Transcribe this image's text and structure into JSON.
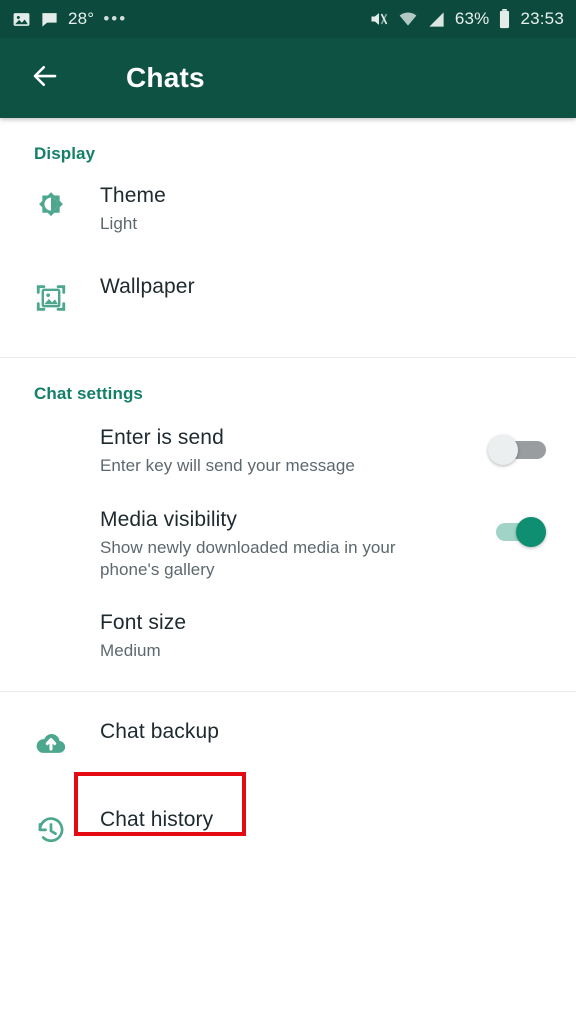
{
  "status_bar": {
    "left_icons": [
      "image-icon",
      "chat-bubble-icon"
    ],
    "temperature": "28°",
    "overflow": "•••",
    "right_icons": [
      "mute-icon",
      "wifi-icon",
      "signal-icon",
      "battery-icon"
    ],
    "battery_percent": "63%",
    "time": "23:53"
  },
  "appbar": {
    "back_icon": "back-arrow-icon",
    "title": "Chats"
  },
  "sections": [
    {
      "title": "Display",
      "rows": [
        {
          "icon": "brightness-icon",
          "title": "Theme",
          "subtitle": "Light"
        },
        {
          "icon": "wallpaper-icon",
          "title": "Wallpaper",
          "subtitle": ""
        }
      ]
    },
    {
      "title": "Chat settings",
      "rows": [
        {
          "icon": "",
          "title": "Enter is send",
          "subtitle": "Enter key will send your message",
          "toggle": "off"
        },
        {
          "icon": "",
          "title": "Media visibility",
          "subtitle": "Show newly downloaded media in your phone's gallery",
          "toggle": "on"
        },
        {
          "icon": "",
          "title": "Font size",
          "subtitle": "Medium"
        }
      ]
    },
    {
      "title": "",
      "rows": [
        {
          "icon": "cloud-upload-icon",
          "title": "Chat backup",
          "subtitle": ""
        },
        {
          "icon": "history-icon",
          "title": "Chat history",
          "subtitle": ""
        }
      ]
    }
  ],
  "annotation": {
    "target": "Chat backup",
    "color": "#e50914"
  },
  "colors": {
    "appbar": "#0e5244",
    "statusbar": "#0b4a3d",
    "accent": "#14806a",
    "icon_teal": "#4da68e",
    "toggle_on": "#0f8f72",
    "highlight": "#e50914"
  }
}
